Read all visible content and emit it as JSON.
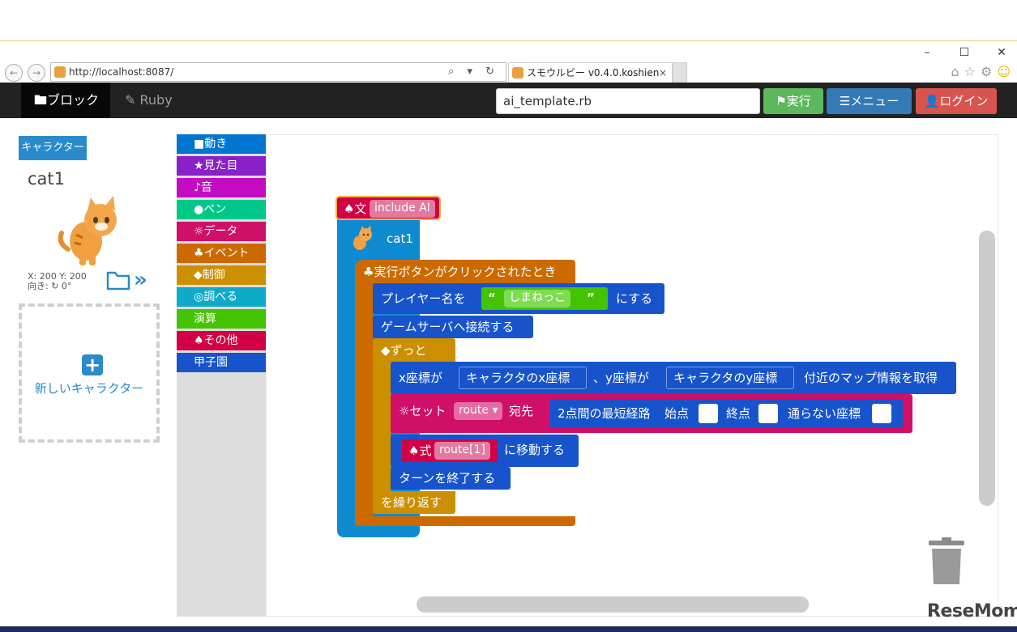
{
  "browser": {
    "url": "http://localhost:8087/",
    "tab_title": "スモウルビー v0.4.0.koshien",
    "tab_close": "×",
    "addr_tools": "⌕ ▾ ↻"
  },
  "navbar": {
    "tab_block": "🖿ブロック",
    "tab_ruby": "✎ Ruby",
    "filename": "ai_template.rb",
    "run_label": "⚑実行",
    "menu_label": "☰メニュー",
    "login_label": "👤ログイン"
  },
  "left_panel": {
    "character_button": "キャラクター",
    "character_name": "cat1",
    "position": "X: 200 Y: 200",
    "direction": "向き: ↻ 0°",
    "new_character": "新しいキャラクター"
  },
  "toolbox": {
    "categories": [
      {
        "label": "■動き",
        "color": "#0076d1"
      },
      {
        "label": "★見た目",
        "color": "#8a20c7"
      },
      {
        "label": "♪音",
        "color": "#c30bc3"
      },
      {
        "label": "●ペン",
        "color": "#00c889"
      },
      {
        "label": "☼データ",
        "color": "#d00f69"
      },
      {
        "label": "♣イベント",
        "color": "#cc6a00"
      },
      {
        "label": "◆制御",
        "color": "#cc8f00"
      },
      {
        "label": "◎調べる",
        "color": "#0eaac9"
      },
      {
        "label": "演算",
        "color": "#44c400"
      },
      {
        "label": "♠その他",
        "color": "#d20044"
      },
      {
        "label": "甲子園",
        "color": "#1754cc"
      }
    ]
  },
  "blocks": {
    "include_prefix": "♠文",
    "include_value": "include AI",
    "character": "cat1",
    "event_hat": "♣実行ボタンがクリックされたとき",
    "set_name_pre": "プレイヤー名を",
    "set_name_value": "しまねっこ",
    "set_name_post": "にする",
    "connect": "ゲームサーバへ接続する",
    "forever": "◆ずっと",
    "map_x_label": "x座標が",
    "map_x_value": "キャラクタのx座標",
    "map_y_label": "、y座標が",
    "map_y_value": "キャラクタのy座標",
    "map_tail": "付近のマップ情報を取得",
    "set_var_label": "☼セット",
    "set_var_value": "route",
    "set_var_dest": "宛先",
    "path_label": "2点間の最短経路",
    "path_start": "始点",
    "path_end": "終点",
    "path_avoid": "通らない座標",
    "move_expr_label": "♠式",
    "move_expr_value": "route[1]",
    "move_tail": "に移動する",
    "end_turn": "ターンを終了する",
    "repeat_tail": "を繰り返す"
  },
  "watermark": "ReseMom."
}
